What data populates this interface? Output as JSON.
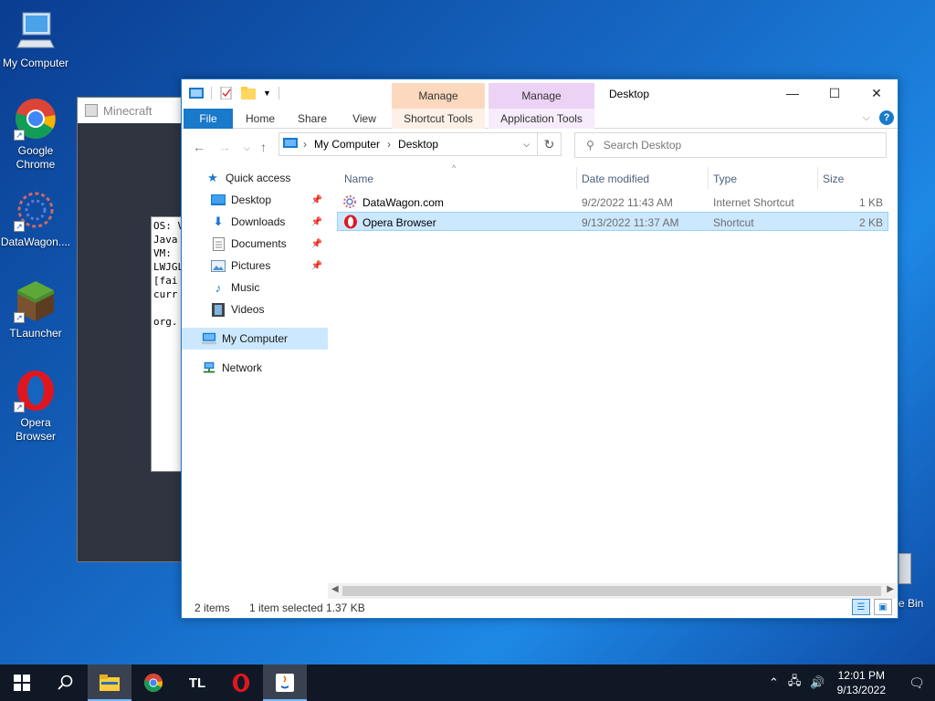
{
  "desktop": {
    "icons": [
      {
        "label": "My Computer"
      },
      {
        "label": "Google Chrome"
      },
      {
        "label": "DataWagon...."
      },
      {
        "label": "TLauncher"
      },
      {
        "label": "Opera Browser"
      }
    ],
    "recycle_label": "e Bin"
  },
  "minecraft": {
    "title": "Minecraft",
    "console_lines": [
      "OS: V",
      "Java",
      "VM: ",
      "LWJGL",
      "[fai",
      "curr",
      "",
      "org."
    ]
  },
  "explorer": {
    "title": "Desktop",
    "context_tabs": {
      "manage1": "Manage",
      "manage2": "Manage"
    },
    "ribbon_tabs": {
      "file": "File",
      "home": "Home",
      "share": "Share",
      "view": "View",
      "shortcut_tools": "Shortcut Tools",
      "application_tools": "Application Tools"
    },
    "breadcrumb": [
      "My Computer",
      "Desktop"
    ],
    "search_placeholder": "Search Desktop",
    "nav": {
      "quick_access": "Quick access",
      "desktop": "Desktop",
      "downloads": "Downloads",
      "documents": "Documents",
      "pictures": "Pictures",
      "music": "Music",
      "videos": "Videos",
      "my_computer": "My Computer",
      "network": "Network"
    },
    "columns": {
      "name": "Name",
      "date": "Date modified",
      "type": "Type",
      "size": "Size"
    },
    "files": [
      {
        "name": "DataWagon.com",
        "date": "9/2/2022 11:43 AM",
        "type": "Internet Shortcut",
        "size": "1 KB"
      },
      {
        "name": "Opera Browser",
        "date": "9/13/2022 11:37 AM",
        "type": "Shortcut",
        "size": "2 KB"
      }
    ],
    "status": {
      "count": "2 items",
      "selected": "1 item selected",
      "size": "1.37 KB"
    }
  },
  "taskbar": {
    "time": "12:01 PM",
    "date": "9/13/2022",
    "tl_label": "TL"
  },
  "colors": {
    "accent": "#1979ca",
    "selection": "#cce8ff"
  }
}
